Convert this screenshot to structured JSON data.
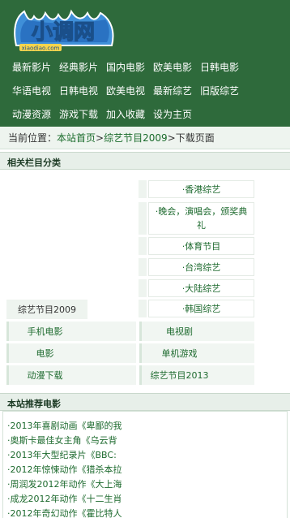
{
  "header": {
    "logo_text": "小调网",
    "logo_url_text": "xiaodiao.com",
    "nav_rows": [
      [
        "最新影片",
        "经典影片",
        "国内电影",
        "欧美电影",
        "日韩电影"
      ],
      [
        "华语电视",
        "日韩电视",
        "欧美电视",
        "最新综艺",
        "旧版综艺"
      ],
      [
        "动漫资源",
        "游戏下载",
        "加入收藏",
        "设为主页"
      ]
    ]
  },
  "breadcrumb": {
    "prefix": "当前位置：",
    "home": "本站首页",
    "sep1": ">",
    "section": "综艺节目2009",
    "sep2": ">",
    "current": "下载页面"
  },
  "related": {
    "title": "相关栏目分类",
    "sub_items": [
      "·香港综艺",
      "·晚会，演唱会，颁奖典礼",
      "·体育节目",
      "·台湾综艺",
      "·大陆综艺",
      "·韩国综艺"
    ],
    "parent_label": "综艺节目2009",
    "grid": [
      [
        "手机电影",
        "电视剧"
      ],
      [
        "电影",
        "单机游戏"
      ],
      [
        "动漫下载",
        "综艺节目2013"
      ]
    ]
  },
  "recommend": {
    "title": "本站推荐电影",
    "items": [
      "·2013年喜剧动画《卑鄙的我",
      "·奥斯卡最佳女主角《乌云背",
      "·2013年大型纪录片《BBC:",
      "·2012年惊悚动作《猎杀本拉",
      "·周润发2012年动作《大上海",
      "·成龙2012年动作《十二生肖",
      "·2012年奇幻动作《霍比特人"
    ]
  },
  "colors": {
    "header_bg": "#2e6a3b",
    "link_green": "#1d6a2e",
    "panel_bg": "#eef4ef"
  }
}
